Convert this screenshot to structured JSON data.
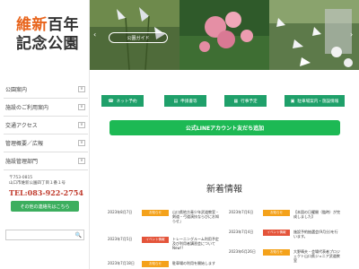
{
  "brand": {
    "line1_accent": "維新",
    "line1_dark": "百年",
    "line2": "記念公園"
  },
  "menu": {
    "items": [
      {
        "label": "公園案内",
        "chevron": "∨"
      },
      {
        "label": "施設のご利用案内",
        "chevron": "∨"
      },
      {
        "label": "交通アクセス",
        "chevron": "∨"
      },
      {
        "label": "管理概要／広報",
        "chevron": "∨"
      },
      {
        "label": "施設管理部門",
        "chevron": "∨"
      }
    ]
  },
  "address": {
    "zip": "〒753-0815",
    "addr": "山口市維新公園四丁目１番１号",
    "tel": "TEL:083-922-2754"
  },
  "inquiry_button": "その他の連絡先はこちら",
  "search": {
    "icon": "search-icon",
    "glyph": "🔍"
  },
  "hero": {
    "button_label": "公園ガイド",
    "prev": "‹",
    "next": "›"
  },
  "quick_buttons": [
    {
      "icon": "phone-icon",
      "glyph": "☎",
      "label": "ネット予約"
    },
    {
      "icon": "document-icon",
      "glyph": "▤",
      "label": "申請書等"
    },
    {
      "icon": "calendar-icon",
      "glyph": "▦",
      "label": "行事予定"
    },
    {
      "icon": "bus-icon",
      "glyph": "▣",
      "label": "駐車場案内・施設情報"
    }
  ],
  "line_button": "公式LINEアカウント友だち追加",
  "news": {
    "title": "新着情報",
    "items": [
      {
        "date": "2023年8月7日",
        "badge": "お知らせ",
        "badge_color": "orange",
        "title": "山口県地方青少年武道教室・剣道・弓道演技ならびにお知らせ」"
      },
      {
        "date": "2023年7月6日",
        "badge": "お知らせ",
        "badge_color": "orange",
        "title": "【本園の日曜開（臨時）が完成しました】"
      },
      {
        "date": "2023年7月5日",
        "badge": "イベント情報",
        "badge_color": "red",
        "title": "トレーニングルーム利用予定及び利用者講習会について New!!"
      },
      {
        "date": "2023年7月4日",
        "badge": "イベント情報",
        "badge_color": "red",
        "title": "施設予約抽選会(9月分)を行います。"
      },
      {
        "date": "2023年7月18日",
        "badge": "お知らせ",
        "badge_color": "orange",
        "title": "駐車場の利用を開始します"
      },
      {
        "date": "2023年6月26日",
        "badge": "お知らせ",
        "badge_color": "orange",
        "title": "大野晴夫・会場代表者プロジェクト山口県ジュニア武道教室"
      }
    ]
  },
  "colors": {
    "accent_orange": "#e8641c",
    "green": "#1fa06a",
    "line_green": "#1db954",
    "tel_red": "#c0392b"
  }
}
